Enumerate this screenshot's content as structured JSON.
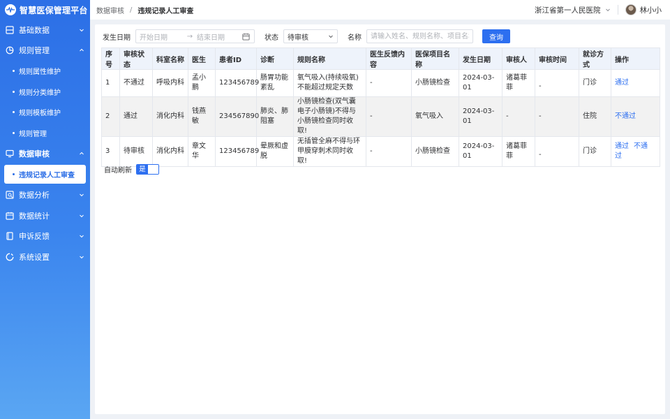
{
  "app": {
    "title": "智慧医保管理平台"
  },
  "sidebar": {
    "items": [
      {
        "label": "基础数据",
        "icon": "database-icon",
        "expanded": false
      },
      {
        "label": "规则管理",
        "icon": "pie-chart-icon",
        "expanded": true,
        "children": [
          "规则属性维护",
          "规则分类维护",
          "规则模板维护",
          "规则管理"
        ]
      },
      {
        "label": "数据审核",
        "icon": "monitor-icon",
        "expanded": true,
        "children": [
          "违规记录人工审查"
        ]
      },
      {
        "label": "数据分析",
        "icon": "analysis-icon",
        "expanded": false
      },
      {
        "label": "数据统计",
        "icon": "calendar-icon",
        "expanded": false
      },
      {
        "label": "申诉反馈",
        "icon": "document-icon",
        "expanded": false
      },
      {
        "label": "系统设置",
        "icon": "settings-icon",
        "expanded": false
      }
    ],
    "active": "违规记录人工审查"
  },
  "header": {
    "breadcrumb": [
      "数据审核",
      "违规记录人工审查"
    ],
    "hospital": "浙江省第一人民医院",
    "user": "林小小"
  },
  "filters": {
    "date_label": "发生日期",
    "date_start_placeholder": "开始日期",
    "date_end_placeholder": "结束日期",
    "status_label": "状态",
    "status_value": "待审核",
    "name_label": "名称",
    "name_placeholder": "请输入姓名、规则名称、项目名称",
    "query_button": "查询"
  },
  "table": {
    "columns": [
      "序号",
      "审核状态",
      "科室名称",
      "医生",
      "患者ID",
      "诊断",
      "规则名称",
      "医生反馈内容",
      "医保项目名称",
      "发生日期",
      "审核人",
      "审核时间",
      "就诊方式",
      "操作"
    ],
    "rows": [
      {
        "no": "1",
        "status": "不通过",
        "dept": "呼吸内科",
        "doctor": "孟小鹏",
        "patient_id": "123456789",
        "diagnosis": "肠胃功能紊乱",
        "rule": "氧气吸入(持续吸氧)不能超过规定天数",
        "feedback": "-",
        "item": "小肠镜检查",
        "date": "2024-03-01",
        "reviewer": "诸葛菲菲",
        "review_time": "-",
        "visit": "门诊",
        "actions": [
          "通过"
        ]
      },
      {
        "no": "2",
        "status": "通过",
        "dept": "消化内科",
        "doctor": "钱燕敏",
        "patient_id": "234567890",
        "diagnosis": "肺炎、肺阻塞",
        "rule": "小肠镜检查(双气囊电子小肠镜)不得与小肠镜检查同时收取!",
        "feedback": "-",
        "item": "氧气吸入",
        "date": "2024-03-01",
        "reviewer": "-",
        "review_time": "-",
        "visit": "住院",
        "actions": [
          "不通过"
        ]
      },
      {
        "no": "3",
        "status": "待审核",
        "dept": "消化内科",
        "doctor": "章文华",
        "patient_id": "123456789",
        "diagnosis": "晕厥和虚脱",
        "rule": "无插管全麻不得与环甲膜穿刺术同时收取!",
        "feedback": "-",
        "item": "小肠镜检查",
        "date": "2024-03-01",
        "reviewer": "诸葛菲菲",
        "review_time": "-",
        "visit": "门诊",
        "actions": [
          "通过",
          "不通过"
        ]
      }
    ]
  },
  "auto_refresh": {
    "label": "自动刷新",
    "value": "是"
  },
  "colors": {
    "primary": "#2d6ff0",
    "fail": "#f5902a",
    "pass": "#22b14c",
    "pending": "#8a8d93"
  }
}
